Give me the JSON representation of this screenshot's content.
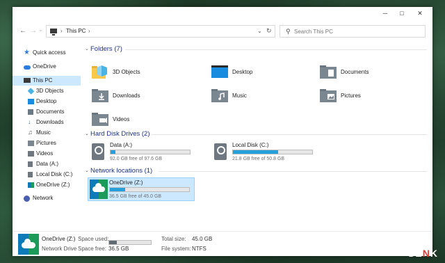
{
  "window": {
    "minimize_glyph": "─",
    "maximize_glyph": "□",
    "close_glyph": "✕"
  },
  "address": {
    "back_glyph": "←",
    "forward_glyph": "→",
    "recent_glyph": "⌄",
    "up_glyph": "↑",
    "path_sep_1": "›",
    "path": "This PC",
    "path_sep_2": "›",
    "dropdown_glyph": "⌄",
    "refresh_glyph": "↻"
  },
  "search": {
    "icon_glyph": "⚲",
    "placeholder": "Search This PC"
  },
  "sidebar": {
    "items": [
      {
        "label": "Quick access",
        "icon": "star-icon"
      },
      {
        "label": "OneDrive",
        "icon": "cloud-icon"
      },
      {
        "label": "This PC",
        "icon": "computer-icon"
      },
      {
        "label": "3D Objects",
        "icon": "cube-icon"
      },
      {
        "label": "Desktop",
        "icon": "desktop-icon"
      },
      {
        "label": "Documents",
        "icon": "document-icon"
      },
      {
        "label": "Downloads",
        "icon": "download-icon"
      },
      {
        "label": "Music",
        "icon": "music-icon"
      },
      {
        "label": "Pictures",
        "icon": "picture-icon"
      },
      {
        "label": "Videos",
        "icon": "video-icon"
      },
      {
        "label": "Data (A:)",
        "icon": "drive-icon"
      },
      {
        "label": "Local Disk (C:)",
        "icon": "drive-icon"
      },
      {
        "label": "OneDrive (Z:)",
        "icon": "network-drive-icon"
      },
      {
        "label": "Network",
        "icon": "network-icon"
      }
    ]
  },
  "folders": {
    "chevron": "⌄",
    "title": "Folders (7)",
    "items": [
      {
        "label": "3D Objects"
      },
      {
        "label": "Desktop"
      },
      {
        "label": "Documents"
      },
      {
        "label": "Downloads"
      },
      {
        "label": "Music"
      },
      {
        "label": "Pictures"
      },
      {
        "label": "Videos"
      }
    ]
  },
  "drives": {
    "chevron": "⌄",
    "title": "Hard Disk Drives (2)",
    "items": [
      {
        "name": "Data (A:)",
        "free_text": "92.0 GB free of 97.6 GB",
        "used_fraction": 0.06
      },
      {
        "name": "Local Disk (C:)",
        "free_text": "21.8 GB free of 50.8 GB",
        "used_fraction": 0.57
      }
    ]
  },
  "network": {
    "chevron": "⌄",
    "title": "Network locations (1)",
    "items": [
      {
        "name": "OneDrive (Z:)",
        "free_text": "36.5 GB free of 45.0 GB",
        "used_fraction": 0.19
      }
    ]
  },
  "details": {
    "name": "OneDrive (Z:)",
    "type": "Network Drive",
    "space_used_label": "Space used:",
    "space_free_label": "Space free:",
    "space_free_value": "36.5 GB",
    "used_fraction": 0.19,
    "total_size_label": "Total size:",
    "total_size_value": "45.0 GB",
    "file_system_label": "File system:",
    "file_system_value": "NTFS"
  },
  "watermark": {
    "prefix": "GE",
    "accent": "N",
    "suffix": "K"
  },
  "colors": {
    "selection": "#cce8ff",
    "section_title": "#1e3287",
    "drive_fill": "#26a0da",
    "folder_yellow": "#f8c94c",
    "folder_gray": "#7a8791"
  }
}
